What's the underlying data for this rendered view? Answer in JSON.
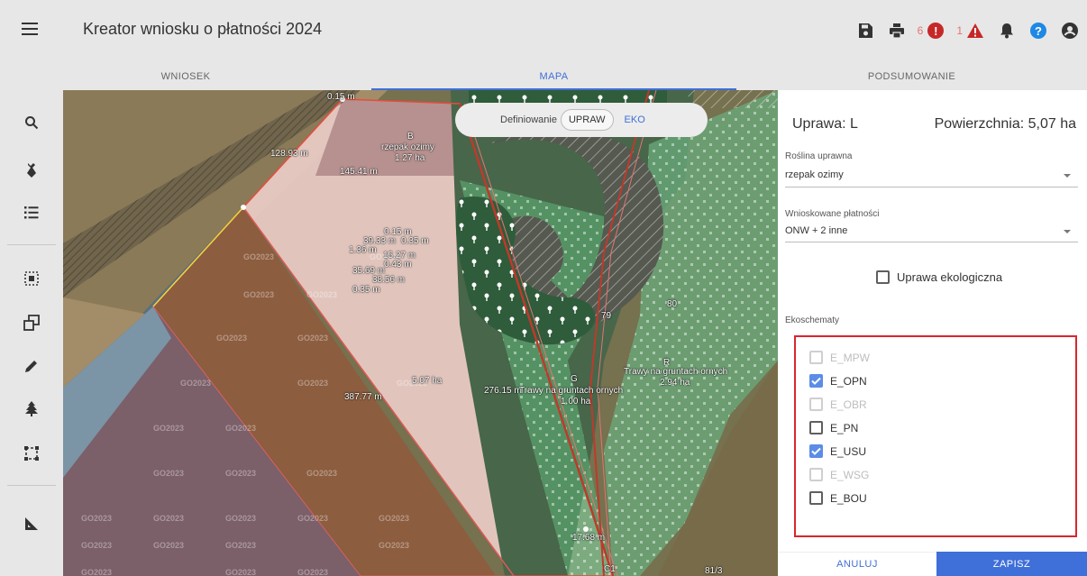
{
  "header": {
    "title": "Kreator wniosku o płatności 2024",
    "menu_icon": "hamburger-menu-icon",
    "icons": [
      "save-icon",
      "print-icon",
      "error-icon",
      "warning-icon",
      "bell-icon",
      "help-icon",
      "account-icon"
    ],
    "error_count": "6",
    "warning_count": "1",
    "colors": {
      "error": "#d32f2f",
      "warning": "#d32f2f",
      "help": "#1e88e5",
      "accent": "#3f6fd8"
    }
  },
  "tabs": [
    {
      "label": "WNIOSEK",
      "active": false
    },
    {
      "label": "MAPA",
      "active": true
    },
    {
      "label": "PODSUMOWANIE",
      "active": false
    }
  ],
  "left_tools": [
    "search-icon",
    "parcel-icon",
    "list-icon",
    "select-area-icon",
    "copy-shape-icon",
    "pencil-icon",
    "tree-icon",
    "bounding-box-icon",
    "measure-icon"
  ],
  "map": {
    "toggle": {
      "label": "Definiowanie",
      "options": [
        "UPRAW",
        "EKO"
      ],
      "selected": "UPRAW"
    },
    "labels": {
      "l1": "0.15 m",
      "l2": "128.93 m",
      "l3": "145.41 m",
      "b_id": "B",
      "b_crop": "rzepak ozimy",
      "b_area": "1.27 ha",
      "m1": "0.15 m",
      "m2": "39.33 m",
      "m3": "0.35 m",
      "m4": "1.36 m",
      "m5": "15.27 m",
      "m6": "0.43 m",
      "m7": "35.69 m",
      "m8": "0.16 m",
      "m9": "38.56 m",
      "m10": "0.35 m",
      "l79": "79",
      "l80": "80",
      "r_id": "R",
      "r_crop": "Trawy na gruntach ornych",
      "r_area": "2.94 ha",
      "g_id": "G",
      "g_len": "276.15 m",
      "g_crop": "Trawy na gruntach ornych",
      "g_area": "1.00 ha",
      "l_area": "5.07 ha",
      "l_len": "387.77 m",
      "bottom_len": "17.68 m",
      "l81": "81/3",
      "l_c1": "C1",
      "watermark": "GO2023"
    }
  },
  "panel": {
    "title": "Uprawa: L",
    "area": "Powierzchnia: 5,07 ha",
    "crop_label": "Roślina uprawna",
    "crop_value": "rzepak ozimy",
    "payment_label": "Wnioskowane płatności",
    "payment_value": "ONW + 2 inne",
    "eko_label": "Uprawa ekologiczna",
    "eko_checked": false,
    "schemes_label": "Ekoschematy",
    "schemes": [
      {
        "label": "E_MPW",
        "checked": false,
        "disabled": true
      },
      {
        "label": "E_OPN",
        "checked": true,
        "disabled": false
      },
      {
        "label": "E_OBR",
        "checked": false,
        "disabled": true
      },
      {
        "label": "E_PN",
        "checked": false,
        "disabled": false
      },
      {
        "label": "E_USU",
        "checked": true,
        "disabled": false
      },
      {
        "label": "E_WSG",
        "checked": false,
        "disabled": true
      },
      {
        "label": "E_BOU",
        "checked": false,
        "disabled": false
      }
    ],
    "highlight_color": "#d9262c",
    "cancel": "ANULUJ",
    "save": "ZAPISZ"
  }
}
